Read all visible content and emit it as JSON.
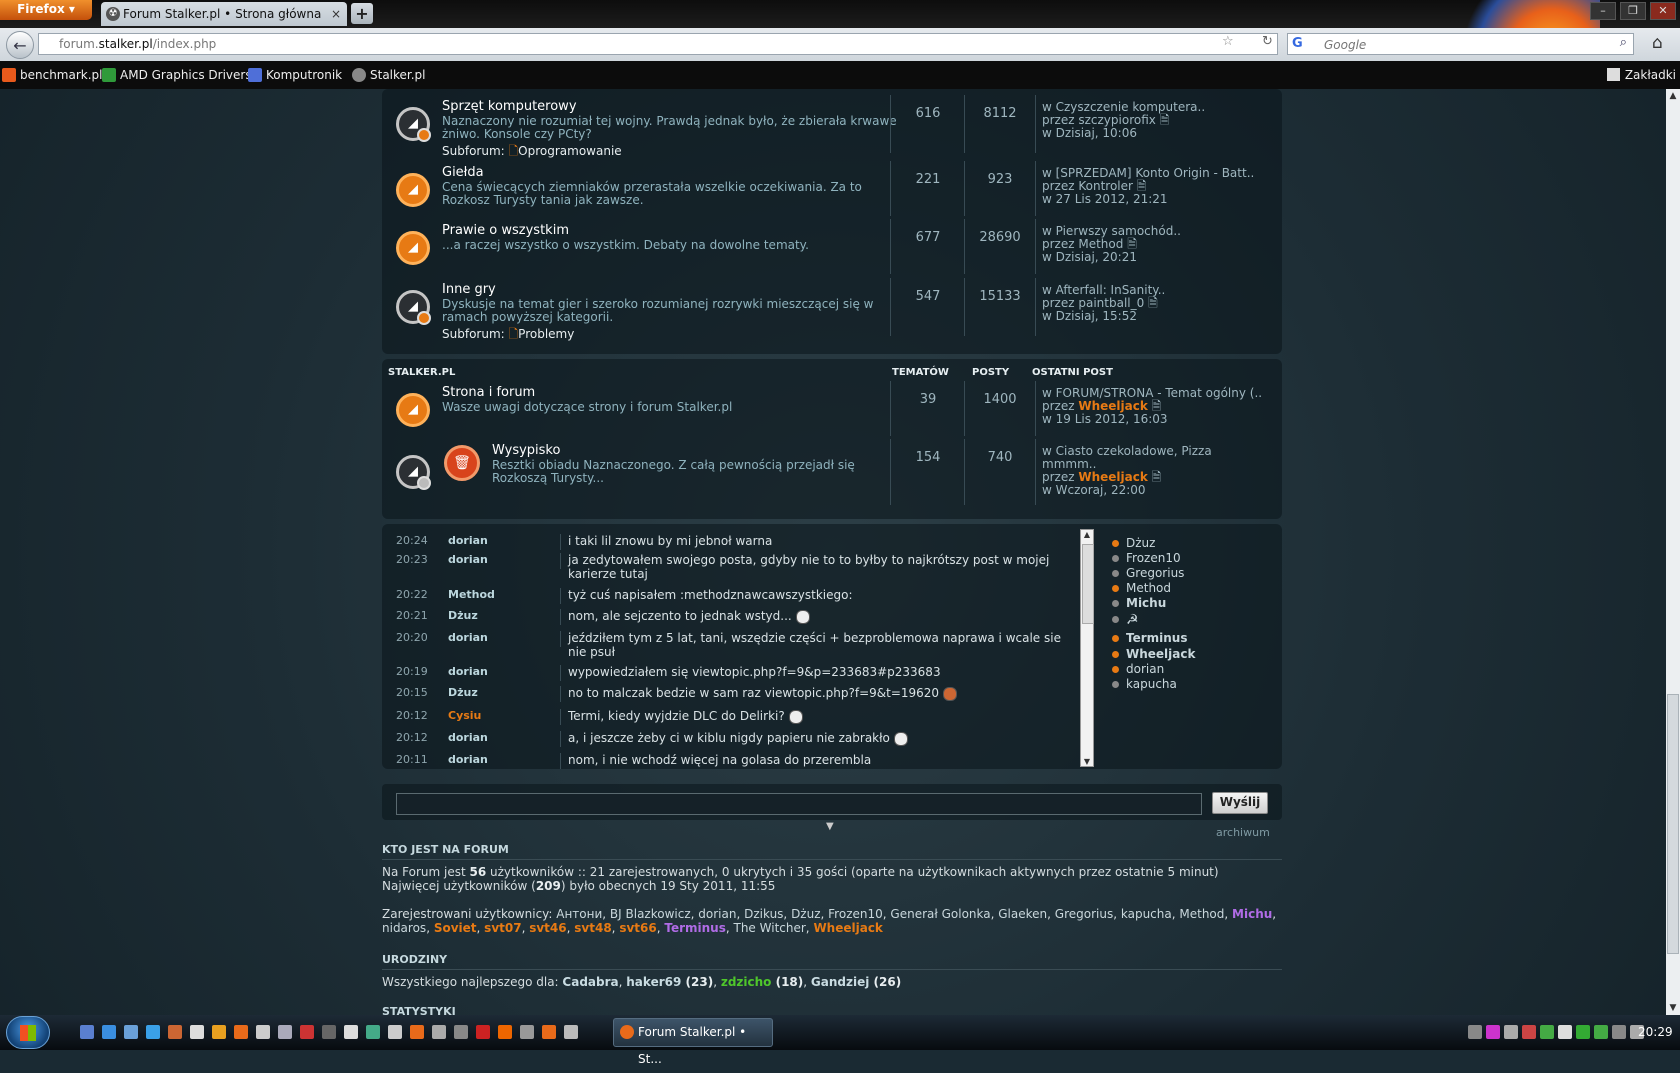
{
  "browser": {
    "menu_label": "Firefox",
    "tab_title": "Forum Stalker.pl • Strona główna",
    "url_prefix": "forum.",
    "url_host": "stalker.pl",
    "url_path": "/index.php",
    "search_placeholder": "Google",
    "bookmarks": [
      "benchmark.pl",
      "AMD Graphics Drivers",
      "Komputronik",
      "Stalker.pl"
    ],
    "bookmarks_right": "Zakładki"
  },
  "forums_top": [
    {
      "title": "Sprzęt komputerowy",
      "desc": "Naznaczony nie rozumiał tej wojny. Prawdą jednak było, że zbierała krwawe żniwo. Konsole czy PCty?",
      "subforum_label": "Subforum:",
      "subforum": "Oprogramowanie",
      "topics": "616",
      "posts": "8112",
      "last_in": "w Czyszczenie komputera..",
      "last_by_label": "przez",
      "last_by": "szczypiorofix",
      "last_date": "w Dzisiaj, 10:06",
      "is_new": false
    },
    {
      "title": "Giełda",
      "desc": "Cena świecących ziemniaków przerastała wszelkie oczekiwania. Za to Rozkosz Turysty tania jak zawsze.",
      "subforum_label": "",
      "subforum": "",
      "topics": "221",
      "posts": "923",
      "last_in": "w [SPRZEDAM] Konto Origin - Batt..",
      "last_by_label": "przez",
      "last_by": "Kontroler",
      "last_date": "w 27 Lis 2012, 21:21",
      "is_new": true
    },
    {
      "title": "Prawie o wszystkim",
      "desc": "...a raczej wszystko o wszystkim. Debaty na dowolne tematy.",
      "subforum_label": "",
      "subforum": "",
      "topics": "677",
      "posts": "28690",
      "last_in": "w Pierwszy samochód..",
      "last_by_label": "przez",
      "last_by": "Method",
      "last_date": "w Dzisiaj, 20:21",
      "is_new": true
    },
    {
      "title": "Inne gry",
      "desc": "Dyskusje na temat gier i szeroko rozumianej rozrywki mieszczącej się w ramach powyższej kategorii.",
      "subforum_label": "Subforum:",
      "subforum": "Problemy",
      "topics": "547",
      "posts": "15133",
      "last_in": "w Afterfall: InSanity..",
      "last_by_label": "przez",
      "last_by": "paintball_0",
      "last_date": "w Dzisiaj, 15:52",
      "is_new": false
    }
  ],
  "category": {
    "name": "STALKER.PL",
    "col_topics": "TEMATÓW",
    "col_posts": "POSTY",
    "col_last": "OSTATNI POST"
  },
  "forums_stalker": [
    {
      "title": "Strona i forum",
      "desc": "Wasze uwagi dotyczące strony i forum Stalker.pl",
      "topics": "39",
      "posts": "1400",
      "last_in": "w FORUM/STRONA - Temat ogólny (..",
      "last_by_label": "przez",
      "last_by": "Wheeljack",
      "last_date": "w 19 Lis 2012, 16:03"
    },
    {
      "title": "Wysypisko",
      "desc": "Resztki obiadu Naznaczonego. Z całą pewnością przejadł się Rozkoszą Turysty...",
      "topics": "154",
      "posts": "740",
      "last_in": "w Ciasto czekoladowe, Pizza mmmm..",
      "last_by_label": "przez",
      "last_by": "Wheeljack",
      "last_date": "w Wczoraj, 22:00"
    }
  ],
  "shouts": [
    {
      "time": "20:24",
      "user": "dorian",
      "msg": "i taki lil znowu by mi jebnoł warna"
    },
    {
      "time": "20:23",
      "user": "dorian",
      "msg": "ja zedytowałem swojego posta, gdyby nie to to byłby to najkrótszy post w mojej karierze tutaj"
    },
    {
      "time": "20:22",
      "user": "Method",
      "msg": "tyż cuś napisałem :methodznawcawszystkiego:"
    },
    {
      "time": "20:21",
      "user": "Dżuz",
      "msg": "nom, ale sejczento to jednak wstyd..."
    },
    {
      "time": "20:20",
      "user": "dorian",
      "msg": "jeździłem tym z 5 lat, tani, wszędzie części + bezproblemowa naprawa i wcale sie nie psuł"
    },
    {
      "time": "20:19",
      "user": "dorian",
      "msg": "wypowiedziałem się viewtopic.php?f=9&p=233683#p233683"
    },
    {
      "time": "20:15",
      "user": "Dżuz",
      "msg": "no to malczak bedzie w sam raz viewtopic.php?f=9&t=19620"
    },
    {
      "time": "20:12",
      "user": "Cysiu",
      "msg": "Termi, kiedy wyjdzie DLC do Delirki?"
    },
    {
      "time": "20:12",
      "user": "dorian",
      "msg": "a, i jeszcze żeby ci w kiblu nigdy papieru nie zabrakło"
    },
    {
      "time": "20:11",
      "user": "dorian",
      "msg": "nom, i nie wchodź więcej na golasa do przerembla"
    }
  ],
  "online_users": [
    {
      "name": "Dżuz",
      "style": "plain",
      "dot": "o"
    },
    {
      "name": "Frozen10",
      "style": "plain",
      "dot": "g"
    },
    {
      "name": "Gregorius",
      "style": "plain",
      "dot": "g"
    },
    {
      "name": "Method",
      "style": "plain",
      "dot": "o"
    },
    {
      "name": "Michu",
      "style": "violet",
      "dot": "g"
    },
    {
      "name": "☭",
      "style": "plain",
      "dot": "g"
    },
    {
      "name": "Terminus",
      "style": "violet",
      "dot": "o"
    },
    {
      "name": "Wheeljack",
      "style": "orange",
      "dot": "o"
    },
    {
      "name": "dorian",
      "style": "plain",
      "dot": "o"
    },
    {
      "name": "kapucha",
      "style": "plain",
      "dot": "g"
    }
  ],
  "shoutbox": {
    "send_label": "Wyślij",
    "archive_label": "archiwum"
  },
  "who": {
    "title": "KTO JEST NA FORUM",
    "line1_pre": "Na Forum jest ",
    "line1_count": "56",
    "line1_post": " użytkowników :: 21 zarejestrowanych, 0 ukrytych i 35 gości (oparte na użytkownikach aktywnych przez ostatnie 5 minut)",
    "line2_pre": "Najwięcej użytkowników (",
    "line2_count": "209",
    "line2_post": ") było obecnych 19 Sty 2011, 11:55",
    "reg_label": "Zarejestrowani użytkownicy: ",
    "reg_users": [
      {
        "name": "Антони",
        "style": "plain"
      },
      {
        "name": "BJ Blazkowicz",
        "style": "plain"
      },
      {
        "name": "dorian",
        "style": "plain"
      },
      {
        "name": "Dzikus",
        "style": "plain"
      },
      {
        "name": "Dżuz",
        "style": "plain"
      },
      {
        "name": "Frozen10",
        "style": "plain"
      },
      {
        "name": "Generał Golonka",
        "style": "plain"
      },
      {
        "name": "Glaeken",
        "style": "plain"
      },
      {
        "name": "Gregorius",
        "style": "plain"
      },
      {
        "name": "kapucha",
        "style": "plain"
      },
      {
        "name": "Method",
        "style": "plain"
      },
      {
        "name": "Michu",
        "style": "violet"
      },
      {
        "name": "nidaros",
        "style": "plain"
      },
      {
        "name": "Soviet",
        "style": "orange"
      },
      {
        "name": "svt07",
        "style": "orange"
      },
      {
        "name": "svt46",
        "style": "orange"
      },
      {
        "name": "svt48",
        "style": "orange"
      },
      {
        "name": "svt66",
        "style": "orange"
      },
      {
        "name": "Terminus",
        "style": "violet"
      },
      {
        "name": "The Witcher",
        "style": "plain"
      },
      {
        "name": "Wheeljack",
        "style": "orange"
      }
    ]
  },
  "birthdays": {
    "title": "URODZINY",
    "pre": "Wszystkiego najlepszego dla: ",
    "people": [
      {
        "name": "Cadabra",
        "age": "",
        "style": "bold"
      },
      {
        "name": "haker69",
        "age": " (23)",
        "style": "bold"
      },
      {
        "name": "zdzicho",
        "age": " (18)",
        "style": "green"
      },
      {
        "name": "Gandziej",
        "age": " (26)",
        "style": "bold"
      }
    ]
  },
  "stats_title": "STATYSTYKI",
  "taskbar": {
    "window_label": "Forum Stalker.pl • St...",
    "clock": "20:29"
  }
}
